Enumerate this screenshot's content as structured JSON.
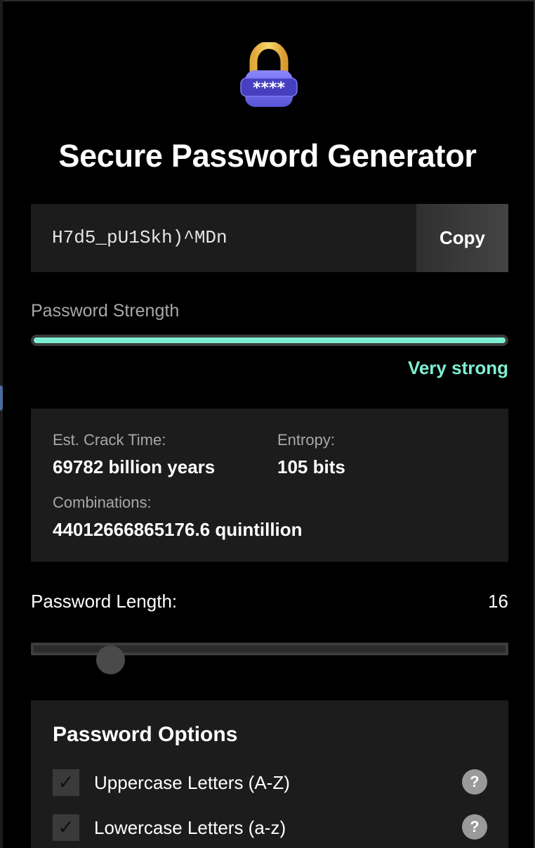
{
  "app": {
    "title": "Secure Password Generator",
    "icon": "lock-with-asterisks-icon",
    "lock_badge": "****"
  },
  "password": {
    "value": "H7d5_pU1Skh)^MDn",
    "copy_label": "Copy"
  },
  "strength": {
    "label": "Password Strength",
    "level_text": "Very strong",
    "fill_fraction": 1.0,
    "color": "#7ef0d2"
  },
  "stats": {
    "crack_time_label": "Est. Crack Time:",
    "crack_time_value": "69782 billion years",
    "entropy_label": "Entropy:",
    "entropy_value": "105 bits",
    "combinations_label": "Combinations:",
    "combinations_value": "44012666865176.6 quintillion"
  },
  "length": {
    "label": "Password Length:",
    "value": "16",
    "slider_fraction": 0.17
  },
  "options": {
    "title": "Password Options",
    "items": [
      {
        "label": "Uppercase Letters (A-Z)",
        "checked": true,
        "check_glyph": "✓",
        "help": "?"
      },
      {
        "label": "Lowercase Letters (a-z)",
        "checked": true,
        "check_glyph": "✓",
        "help": "?"
      }
    ]
  },
  "colors": {
    "background": "#000000",
    "panel": "#1c1c1c",
    "accent": "#7ef0d2",
    "lock_body": "#6f6ef0",
    "lock_shackle": "#f2c24a"
  }
}
